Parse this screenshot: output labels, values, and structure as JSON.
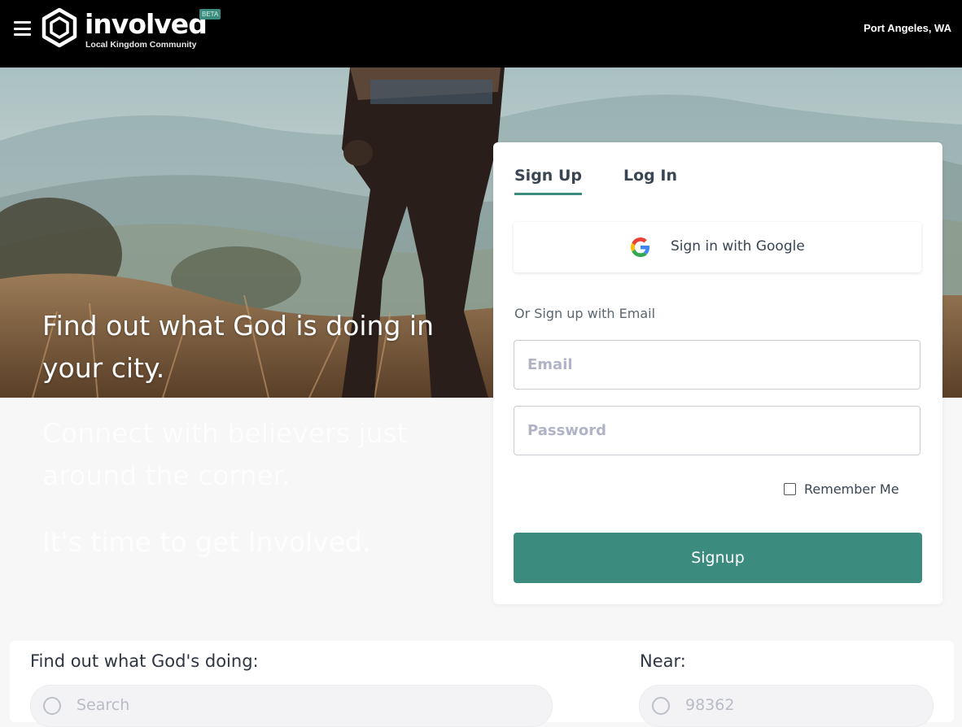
{
  "header": {
    "brand": "involved",
    "beta_badge": "BETA",
    "tagline": "Local Kingdom Community",
    "location": "Port Angeles, WA",
    "icons": [
      "hamburger-icon",
      "hexagon-logo-icon"
    ]
  },
  "hero": {
    "headline": "Find out what God is doing in your city.",
    "line2": "Connect with believers just around the corner.",
    "line3": "It's time to get Involved."
  },
  "auth": {
    "tabs": [
      {
        "label": "Sign Up",
        "active": true
      },
      {
        "label": "Log In",
        "active": false
      }
    ],
    "google_button": "Sign in with Google",
    "or_label": "Or Sign up with Email",
    "email_placeholder": "Email",
    "password_placeholder": "Password",
    "remember_label": "Remember Me",
    "submit_label": "Signup"
  },
  "search": {
    "what_label": "Find out what God's doing:",
    "what_placeholder": "Search",
    "near_label": "Near:",
    "near_placeholder": "98362"
  },
  "colors": {
    "accent": "#3b8c7e",
    "header_bg": "#000000"
  }
}
